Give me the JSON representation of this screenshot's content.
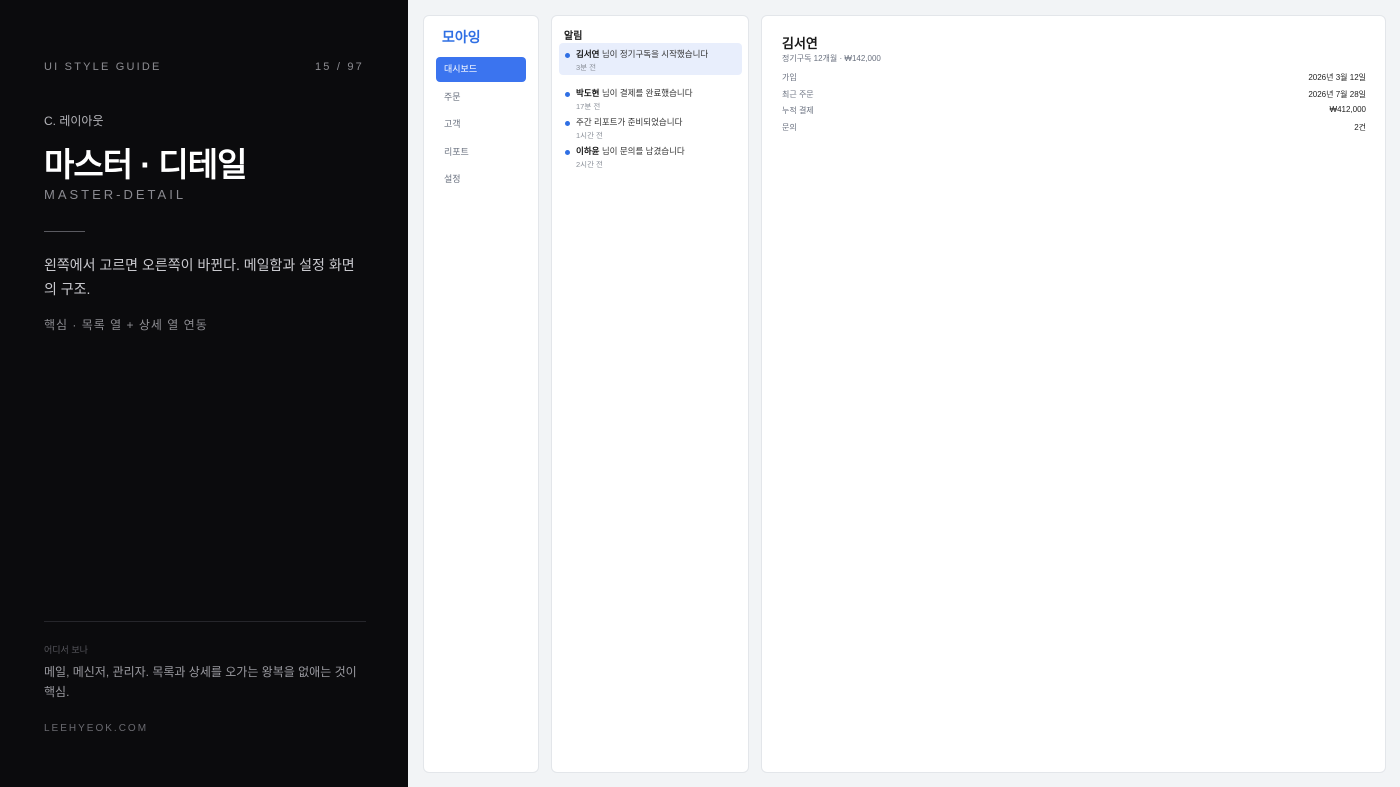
{
  "guide": {
    "label": "UI STYLE GUIDE",
    "page": "15 / 97",
    "section": "C. 레이아웃",
    "title": "마스터 · 디테일",
    "subtitle": "MASTER-DETAIL",
    "description": "왼쪽에서 고르면 오른쪽이 바뀐다. 메일함과 설정 화면의 구조.",
    "core": "핵심 · 목록 열 + 상세 열 연동",
    "where_label": "어디서 보나",
    "where_text": "메일, 메신저, 관리자. 목록과 상세를 오가는 왕복을 없애는 것이 핵심.",
    "site": "LEEHYEOK.COM"
  },
  "app": {
    "brand": "모아잉",
    "accent": "#3b74ef",
    "nav": {
      "items": [
        {
          "label": "대시보드",
          "active": true
        },
        {
          "label": "주문"
        },
        {
          "label": "고객"
        },
        {
          "label": "리포트"
        },
        {
          "label": "설정"
        }
      ]
    },
    "notifications": {
      "title": "알림",
      "items": [
        {
          "name": "김서연",
          "text": " 님이 정기구독을 시작했습니다",
          "time": "3분 전",
          "selected": true
        },
        {
          "name": "박도현",
          "text": " 님이 결제를 완료했습니다",
          "time": "17분 전"
        },
        {
          "name": "",
          "text": "주간 리포트가 준비되었습니다",
          "time": "1시간 전"
        },
        {
          "name": "이하윤",
          "text": " 님이 문의를 남겼습니다",
          "time": "2시간 전"
        }
      ]
    },
    "detail": {
      "name": "김서연",
      "meta": "정기구독 12개월 · ₩142,000",
      "rows": [
        {
          "key": "가입",
          "value": "2026년 3월 12일"
        },
        {
          "key": "최근 주문",
          "value": "2026년 7월 28일"
        },
        {
          "key": "누적 결제",
          "value": "₩412,000"
        },
        {
          "key": "문의",
          "value": "2건"
        }
      ]
    }
  }
}
